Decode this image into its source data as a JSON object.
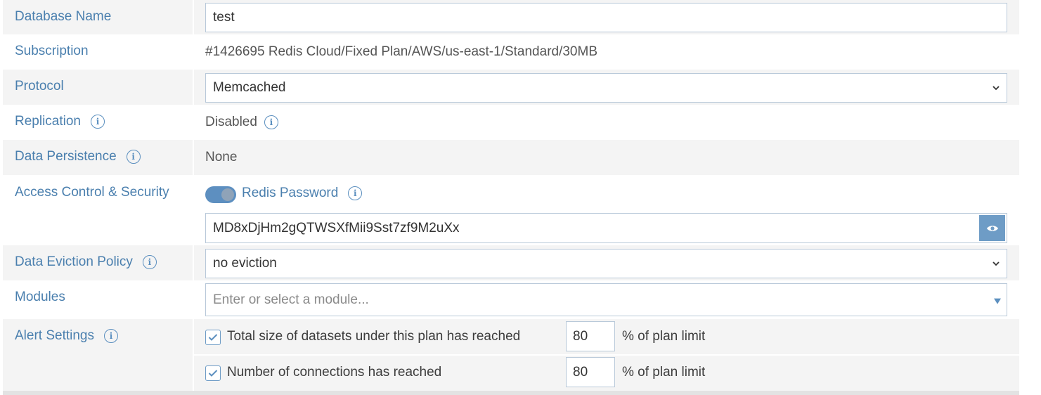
{
  "fields": {
    "database_name": {
      "label": "Database Name",
      "value": "test"
    },
    "subscription": {
      "label": "Subscription",
      "value": "#1426695 Redis Cloud/Fixed Plan/AWS/us-east-1/Standard/30MB"
    },
    "protocol": {
      "label": "Protocol",
      "value": "Memcached"
    },
    "replication": {
      "label": "Replication",
      "value": "Disabled"
    },
    "data_persistence": {
      "label": "Data Persistence",
      "value": "None"
    },
    "access_control": {
      "label": "Access Control & Security",
      "toggle_label": "Redis Password",
      "toggle_on": true,
      "password": "MD8xDjHm2gQTWSXfMii9Sst7zf9M2uXx"
    },
    "eviction": {
      "label": "Data Eviction Policy",
      "value": "no eviction"
    },
    "modules": {
      "label": "Modules",
      "placeholder": "Enter or select a module..."
    },
    "alerts": {
      "label": "Alert Settings",
      "items": [
        {
          "text": "Total size of datasets under this plan has reached",
          "checked": true,
          "value": "80",
          "suffix": "% of plan limit"
        },
        {
          "text": "Number of connections has reached",
          "checked": true,
          "value": "80",
          "suffix": "% of plan limit"
        }
      ]
    }
  },
  "icons": {
    "info": "info-icon",
    "dropdown": "chevron-down-icon",
    "eye": "eye-icon",
    "check": "checkmark-icon"
  },
  "colors": {
    "accent": "#4a7fae",
    "row_alt": "#f4f4f4",
    "toggle": "#5d8fc0"
  }
}
